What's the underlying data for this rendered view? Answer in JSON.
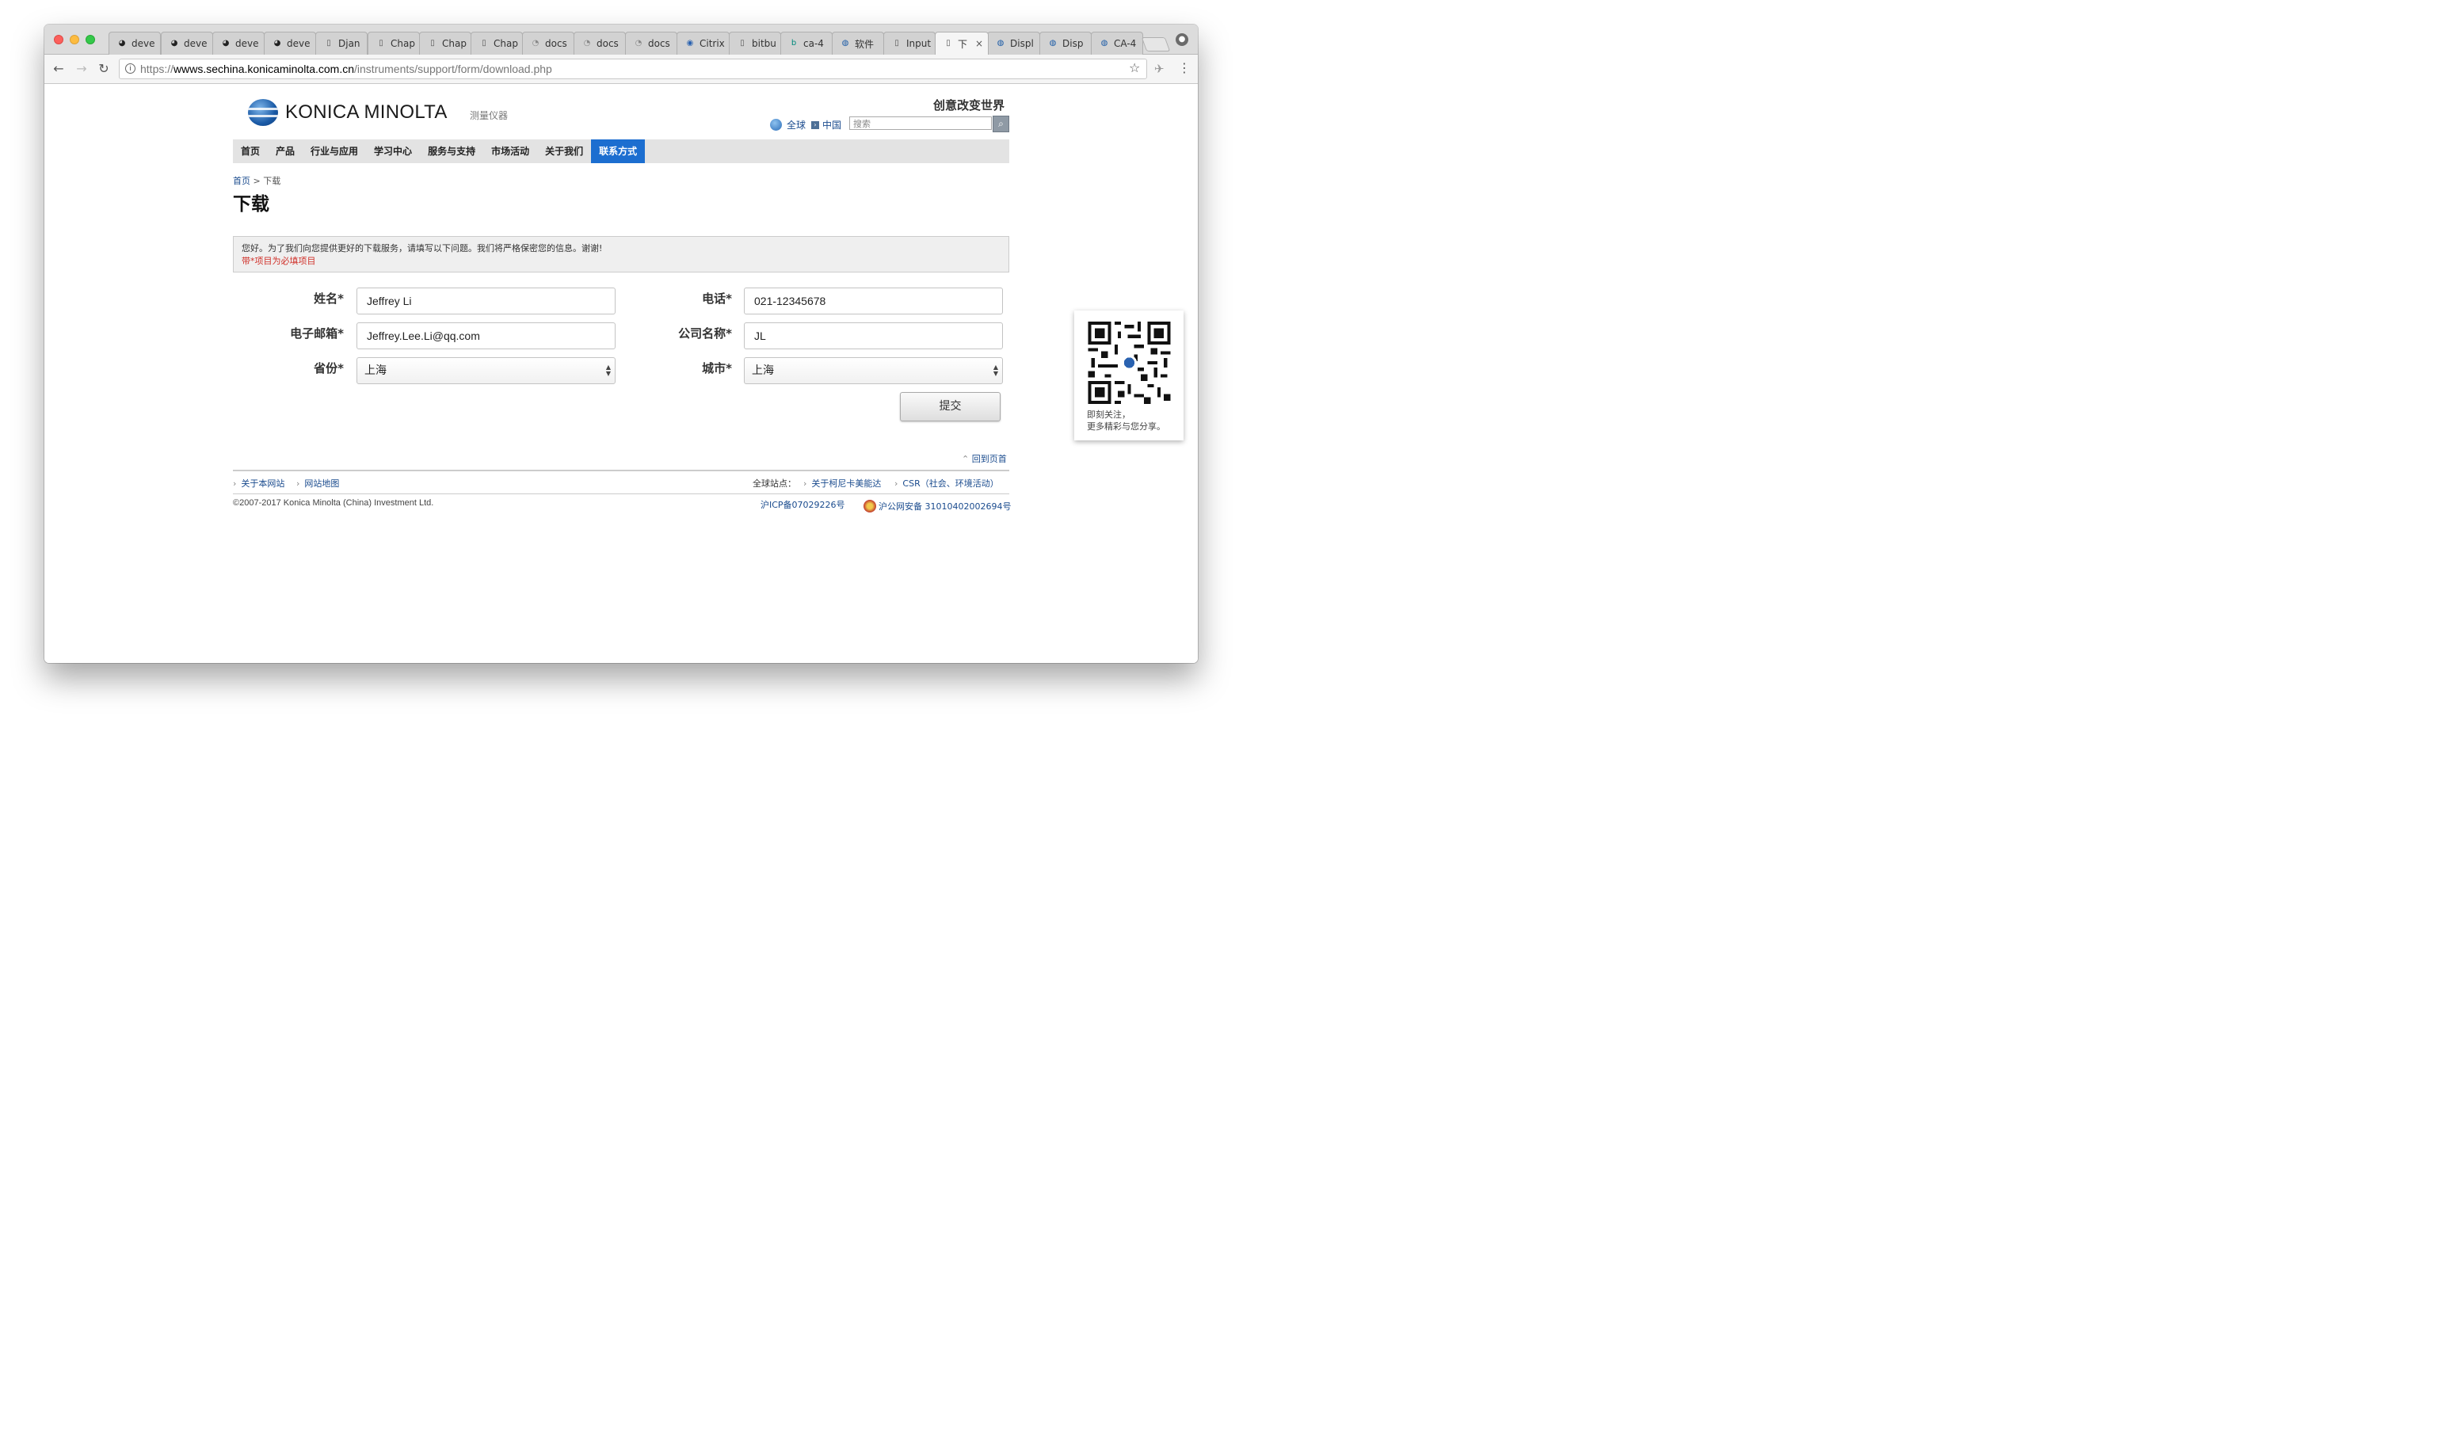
{
  "browser": {
    "tabs": [
      {
        "label": "deve",
        "icon": "github-icon"
      },
      {
        "label": "deve",
        "icon": "github-icon"
      },
      {
        "label": "deve",
        "icon": "github-icon"
      },
      {
        "label": "deve",
        "icon": "github-icon"
      },
      {
        "label": "Djan",
        "icon": "page-icon"
      },
      {
        "label": "Chap",
        "icon": "page-icon"
      },
      {
        "label": "Chap",
        "icon": "page-icon"
      },
      {
        "label": "Chap",
        "icon": "page-icon"
      },
      {
        "label": "docs",
        "icon": "docs-icon"
      },
      {
        "label": "docs",
        "icon": "docs-icon"
      },
      {
        "label": "docs",
        "icon": "docs-icon"
      },
      {
        "label": "Citrix",
        "icon": "citrix-icon"
      },
      {
        "label": "bitbu",
        "icon": "page-icon"
      },
      {
        "label": "ca-4",
        "icon": "bing-icon"
      },
      {
        "label": "软件",
        "icon": "konica-icon"
      },
      {
        "label": "Input",
        "icon": "page-icon"
      },
      {
        "label": "下",
        "icon": "page-icon",
        "close": "×"
      },
      {
        "label": "Displ",
        "icon": "konica-icon"
      },
      {
        "label": "Disp",
        "icon": "konica-icon"
      },
      {
        "label": "CA-4",
        "icon": "konica-icon"
      }
    ],
    "url_prefix": "https://",
    "url_host": "wwws.sechina.konicaminolta.com.cn",
    "url_path": "/instruments/support/form/download.php",
    "info_glyph": "i",
    "back_glyph": "←",
    "forward_glyph": "→",
    "reload_glyph": "↻",
    "star_glyph": "☆",
    "menu_glyph": "⋮"
  },
  "header": {
    "brand": "KONICA MINOLTA",
    "subtitle": "测量仪器",
    "slogan": "创意改变世界",
    "global_label": "全球",
    "china_label": "中国",
    "search_placeholder": "搜索"
  },
  "nav": {
    "items": [
      "首页",
      "产品",
      "行业与应用",
      "学习中心",
      "服务与支持",
      "市场活动",
      "关于我们",
      "联系方式"
    ],
    "active_index": 7
  },
  "breadcrumb": {
    "home": "首页",
    "separator": ">",
    "current": "下载"
  },
  "page_title": "下载",
  "notice": {
    "message": "您好。为了我们向您提供更好的下载服务，请填写以下问题。我们将严格保密您的信息。谢谢!",
    "required_note": "带*项目为必填项目"
  },
  "form": {
    "name_label": "姓名*",
    "name_value": "Jeffrey Li",
    "phone_label": "电话*",
    "phone_value": "021-12345678",
    "email_label": "电子邮箱*",
    "email_value": "Jeffrey.Lee.Li@qq.com",
    "company_label": "公司名称*",
    "company_value": "JL",
    "province_label": "省份*",
    "province_value": "上海",
    "city_label": "城市*",
    "city_value": "上海",
    "submit_label": "提交"
  },
  "qr": {
    "line1": "即刻关注，",
    "line2": "更多精彩与您分享。"
  },
  "footer": {
    "to_top": "回到页首",
    "about_site": "关于本网站",
    "sitemap": "网站地图",
    "global_sites": "全球站点：",
    "about_konica": "关于柯尼卡美能达",
    "csr": "CSR（社会、环境活动）",
    "copyright": "©2007-2017 Konica Minolta (China) Investment Ltd.",
    "icp": "沪ICP备07029226号",
    "police": "沪公网安备 31010402002694号"
  }
}
